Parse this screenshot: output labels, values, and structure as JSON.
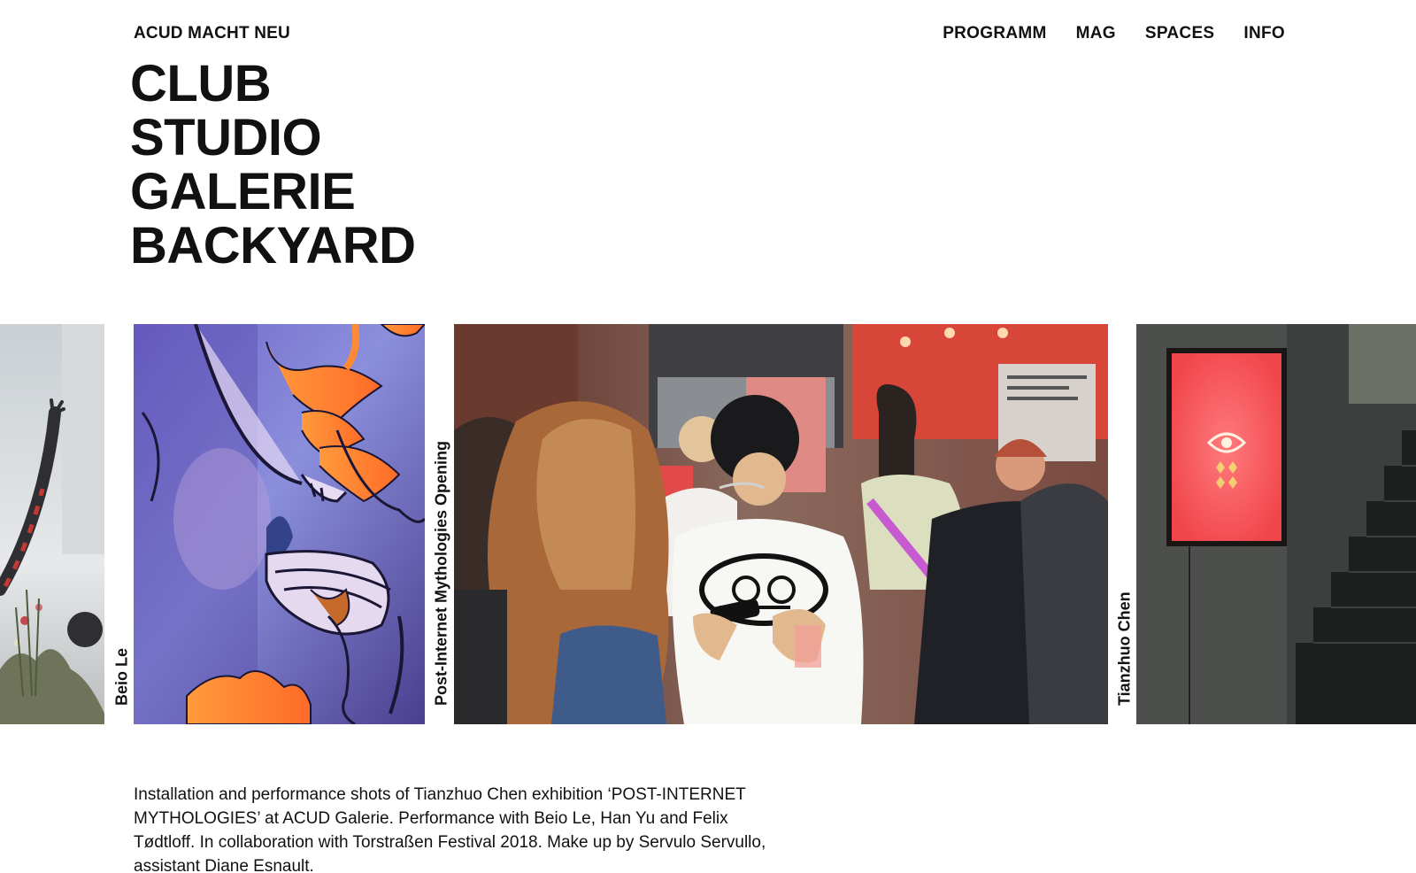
{
  "header": {
    "brand": "ACUD MACHT NEU",
    "nav": [
      "PROGRAMM",
      "MAG",
      "SPACES",
      "INFO"
    ]
  },
  "spaces": [
    "CLUB",
    "STUDIO",
    "GALERIE",
    "BACKYARD"
  ],
  "gallery": {
    "captions": [
      "Beio Le",
      "Post-Internet Mythologies Opening",
      "Tianzhuo Chen"
    ]
  },
  "description": "Installation and performance shots of Tianzhuo Chen exhibition ‘POST-INTERNET MYTHOLOGIES’ at ACUD Galerie. Performance with Beio Le, Han Yu and Felix Tødtloff. In collaboration with Torstraßen Festival 2018. Make up by Servulo Servullo, assistant Diane Esnault.",
  "colors": {
    "text": "#111111",
    "background": "#ffffff",
    "flame_orange": "#ff7a2a",
    "screen_red": "#f0454a"
  }
}
